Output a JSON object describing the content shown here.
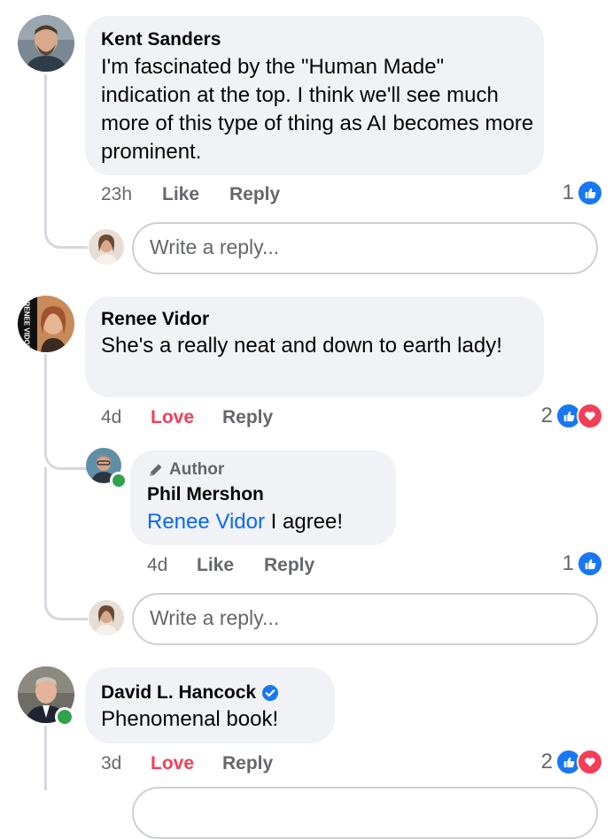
{
  "comments": [
    {
      "author": "Kent Sanders",
      "text": "I'm fascinated by the \"Human Made\" indication at the top. I think we'll see much more of this type of thing as AI becomes more prominent.",
      "time": "23h",
      "action": "Like",
      "reply": "Reply",
      "reactions_count": "1"
    },
    {
      "author": "Renee Vidor",
      "text": "She's a really neat and down to earth lady!",
      "time": "4d",
      "action": "Love",
      "reply": "Reply",
      "reactions_count": "2",
      "avatar_text": "RENEE VIDOR"
    },
    {
      "author": "David L. Hancock",
      "text": "Phenomenal book!",
      "time": "3d",
      "action": "Love",
      "reply": "Reply",
      "reactions_count": "2"
    }
  ],
  "author_reply": {
    "badge": "Author",
    "author": "Phil Mershon",
    "mention": "Renee Vidor",
    "text": "I agree!",
    "time": "4d",
    "action": "Like",
    "reply": "Reply",
    "reactions_count": "1"
  },
  "reply_input": {
    "placeholder": "Write a reply..."
  },
  "icons": {
    "like": "thumbs-up-icon",
    "love": "heart-icon",
    "author": "pencil-icon",
    "verified": "verified-badge-icon"
  },
  "colors": {
    "like_blue": "#1877f2",
    "love_red": "#f33e58",
    "mention_blue": "#0866ff",
    "meta_gray": "#65676b",
    "bubble_bg": "#f0f2f5",
    "online_green": "#31a24c"
  }
}
